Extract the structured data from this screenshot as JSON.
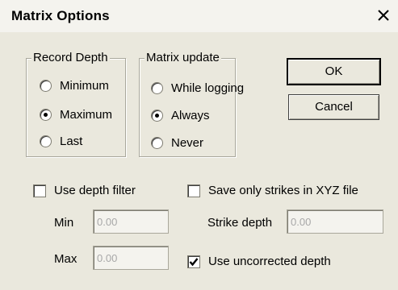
{
  "window": {
    "title": "Matrix Options",
    "close_glyph": "✕"
  },
  "record_depth": {
    "legend": "Record Depth",
    "options": [
      {
        "label": "Minimum",
        "checked": false
      },
      {
        "label": "Maximum",
        "checked": true
      },
      {
        "label": "Last",
        "checked": false
      }
    ]
  },
  "matrix_update": {
    "legend": "Matrix update",
    "options": [
      {
        "label": "While logging",
        "checked": false
      },
      {
        "label": "Always",
        "checked": true
      },
      {
        "label": "Never",
        "checked": false
      }
    ]
  },
  "buttons": {
    "ok": "OK",
    "cancel": "Cancel"
  },
  "depth_filter": {
    "label": "Use depth filter",
    "checked": false,
    "min_label": "Min",
    "min_value": "0.00",
    "max_label": "Max",
    "max_value": "0.00"
  },
  "strikes": {
    "label": "Save only strikes in XYZ file",
    "checked": false,
    "strike_depth_label": "Strike depth",
    "strike_depth_value": "0.00"
  },
  "uncorrected": {
    "label": "Use uncorrected depth",
    "checked": true
  },
  "colors": {
    "dialog_bg": "#eae8dd",
    "disabled_text": "#a8a8a8"
  }
}
